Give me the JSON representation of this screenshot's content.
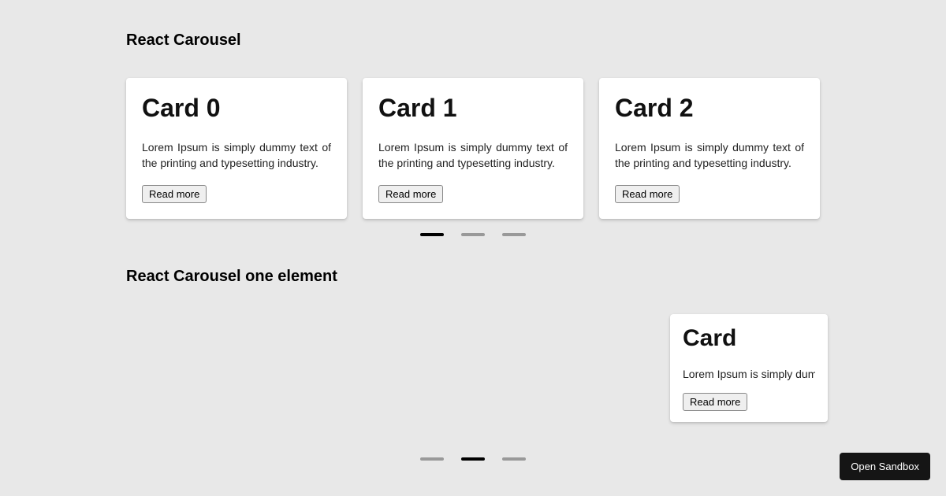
{
  "section1": {
    "title": "React Carousel",
    "cards": [
      {
        "title": "Card 0",
        "text": "Lorem Ipsum is simply dummy text of the printing and typesetting industry.",
        "button": "Read more"
      },
      {
        "title": "Card 1",
        "text": "Lorem Ipsum is simply dummy text of the printing and typesetting industry.",
        "button": "Read more"
      },
      {
        "title": "Card 2",
        "text": "Lorem Ipsum is simply dummy text of the printing and typesetting industry.",
        "button": "Read more"
      }
    ],
    "activeDot": 0,
    "dotCount": 3
  },
  "section2": {
    "title": "React Carousel one element",
    "card": {
      "title": "Card",
      "text": "Lorem Ipsum is simply dummy",
      "button": "Read more"
    },
    "activeDot": 1,
    "dotCount": 3
  },
  "sandbox": {
    "label": "Open Sandbox"
  }
}
